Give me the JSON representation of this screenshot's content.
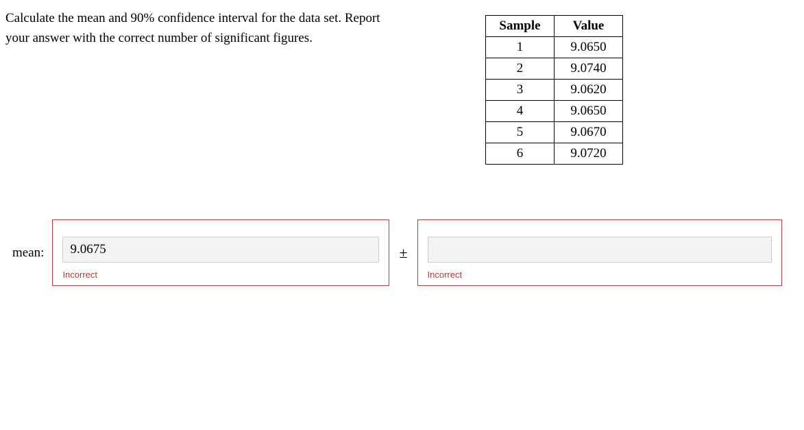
{
  "prompt": "Calculate the mean and 90% confidence interval for the data set. Report your answer with the correct number of significant figures.",
  "table": {
    "headers": {
      "sample": "Sample",
      "value": "Value"
    },
    "rows": [
      {
        "sample": "1",
        "value": "9.0650"
      },
      {
        "sample": "2",
        "value": "9.0740"
      },
      {
        "sample": "3",
        "value": "9.0620"
      },
      {
        "sample": "4",
        "value": "9.0650"
      },
      {
        "sample": "5",
        "value": "9.0670"
      },
      {
        "sample": "6",
        "value": "9.0720"
      }
    ]
  },
  "labels": {
    "mean": "mean:",
    "plusminus": "±"
  },
  "inputs": {
    "mean_value": "9.0675",
    "ci_value": ""
  },
  "feedback": {
    "mean": "Incorrect",
    "ci": "Incorrect"
  }
}
